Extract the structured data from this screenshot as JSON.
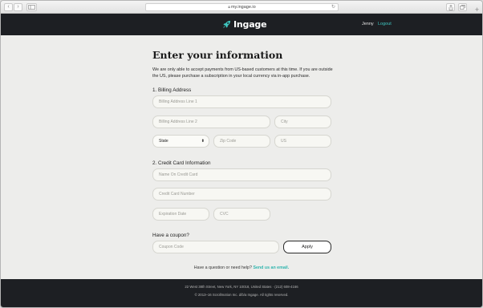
{
  "browser": {
    "url": "my.ingage.io",
    "back_icon": "chevron-left",
    "forward_icon": "chevron-right",
    "sidebar_icon": "sidebar",
    "share_icon": "share",
    "tabs_icon": "tabs",
    "new_tab_icon": "plus"
  },
  "header": {
    "logo_text": "Ingage",
    "logo_icon": "rocket",
    "user_name": "Jenny",
    "logout_label": "Logout",
    "accent_color": "#3fc6c0"
  },
  "page": {
    "title": "Enter your information",
    "notice": "We are only able to accept payments from US-based customers at this time. If you are outside the US, please purchase a subscription in your local currency via in-app purchase."
  },
  "billing": {
    "section_label": "1. Billing Address",
    "line1_placeholder": "Billing Address Line 1",
    "line2_placeholder": "Billing Address Line 2",
    "city_placeholder": "City",
    "state_value": "State",
    "zip_placeholder": "Zip Code",
    "country_value": "US"
  },
  "card": {
    "section_label": "2. Credit Card Information",
    "name_placeholder": "Name On Credit Card",
    "number_placeholder": "Credit Card Number",
    "expiration_placeholder": "Expiration Date",
    "cvc_placeholder": "CVC"
  },
  "coupon": {
    "section_label": "Have a coupon?",
    "code_placeholder": "Coupon Code",
    "apply_label": "Apply"
  },
  "help": {
    "text": "Have a question or need help?",
    "link_label": "Send us an email."
  },
  "footer": {
    "address": "22 West 38th Street, New York, NY 10018, United States · (212) 608-4166",
    "copyright": "© 2013–16 Scrollmotion Inc. d/b/a Ingage. All rights reserved."
  }
}
